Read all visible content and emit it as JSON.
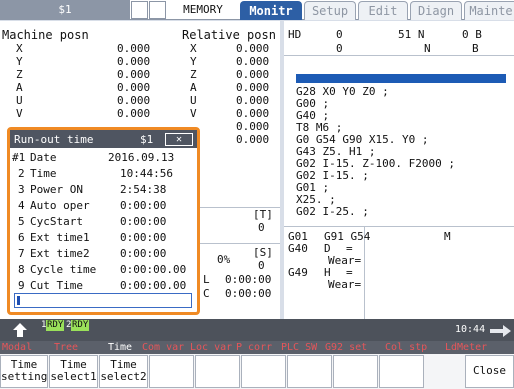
{
  "header": {
    "system_name": "$1",
    "mode": "MEMORY",
    "tabs": [
      "Monitr",
      "Setup",
      "Edit",
      "Diagn",
      "Mainte"
    ]
  },
  "machine_posn": {
    "title": "Machine posn",
    "axes": [
      {
        "name": "X",
        "value": "0.000"
      },
      {
        "name": "Y",
        "value": "0.000"
      },
      {
        "name": "Z",
        "value": "0.000"
      },
      {
        "name": "A",
        "value": "0.000"
      },
      {
        "name": "U",
        "value": "0.000"
      },
      {
        "name": "V",
        "value": "0.000"
      }
    ]
  },
  "relative_posn": {
    "title": "Relative posn",
    "axes": [
      {
        "name": "X",
        "value": "0.000"
      },
      {
        "name": "Y",
        "value": "0.000"
      },
      {
        "name": "Z",
        "value": "0.000"
      },
      {
        "name": "A",
        "value": "0.000"
      },
      {
        "name": "U",
        "value": "0.000"
      },
      {
        "name": "V",
        "value": "0.000"
      }
    ],
    "extra_values": [
      "0.000",
      "0.000"
    ]
  },
  "feed_area": {
    "t_label": "[T]",
    "t_value": "0",
    "s_label": "[S]",
    "s_value": "0",
    "percent": "0%",
    "l_label": "L",
    "l_value": "0:00:00",
    "c_label": "C",
    "c_value": "0:00:00"
  },
  "program": {
    "hd_label": "HD",
    "hd_values": [
      "0",
      "0"
    ],
    "n_labels": [
      "51 N",
      "N"
    ],
    "b_labels": [
      "0 B",
      "B"
    ],
    "lines": [
      "G28 X0 Y0 Z0 ;",
      "G00 ;",
      "G40 ;",
      "T8 M6 ;",
      "G0 G54 G90 X15. Y0 ;",
      "G43 Z5. H1 ;",
      "G02 I-15. Z-100. F2000 ;",
      "G02 I-15. ;",
      "G01 ;",
      "X25. ;",
      "G02 I-25. ;"
    ],
    "modal": {
      "row1": [
        "G01",
        "G91 G54"
      ],
      "row2": [
        "G40",
        "D",
        "="
      ],
      "wear1": "Wear=",
      "row3": [
        "G49",
        "H",
        "="
      ],
      "wear2": "Wear=",
      "m_label": "M"
    }
  },
  "runout": {
    "title": "Run-out time",
    "system": "$1",
    "close": "✕",
    "rows": [
      {
        "num": "#1",
        "label": "Date",
        "value": "2016.09.13"
      },
      {
        "num": "2",
        "label": "Time",
        "value": "10:44:56"
      },
      {
        "num": "3",
        "label": "Power ON",
        "value": "2:54:38"
      },
      {
        "num": "4",
        "label": "Auto oper",
        "value": "0:00:00"
      },
      {
        "num": "5",
        "label": "CycStart",
        "value": "0:00:00"
      },
      {
        "num": "6",
        "label": "Ext time1",
        "value": "0:00:00"
      },
      {
        "num": "7",
        "label": "Ext time2",
        "value": "0:00:00"
      },
      {
        "num": "8",
        "label": "Cycle time",
        "value": "0:00:00.00"
      },
      {
        "num": "9",
        "label": "Cut Time",
        "value": "0:00:00.00"
      }
    ]
  },
  "status": {
    "badge1_num": "1",
    "badge1_text": "RDY",
    "badge2_num": "2",
    "badge2_text": "RDY",
    "clock": "10:44"
  },
  "menus": [
    "Modal",
    "Tree",
    "Time",
    "Com var",
    "Loc var",
    "P corr",
    "PLC SW",
    "G92 set",
    "Col stp",
    "LdMeter"
  ],
  "softkeys": [
    {
      "line1": "Time",
      "line2": "setting"
    },
    {
      "line1": "Time",
      "line2": "select1"
    },
    {
      "line1": "Time",
      "line2": "select2"
    },
    {
      "line1": "",
      "line2": ""
    },
    {
      "line1": "",
      "line2": ""
    },
    {
      "line1": "",
      "line2": ""
    },
    {
      "line1": "",
      "line2": ""
    },
    {
      "line1": "",
      "line2": ""
    },
    {
      "line1": "",
      "line2": ""
    },
    {
      "line1": "Close",
      "line2": ""
    }
  ],
  "colors": {
    "accent": "#2d5fa5",
    "popup_border": "#f08a24",
    "rdy": "#9ae05a",
    "menu_text": "#e5565a",
    "status_bar": "#4d525b"
  }
}
